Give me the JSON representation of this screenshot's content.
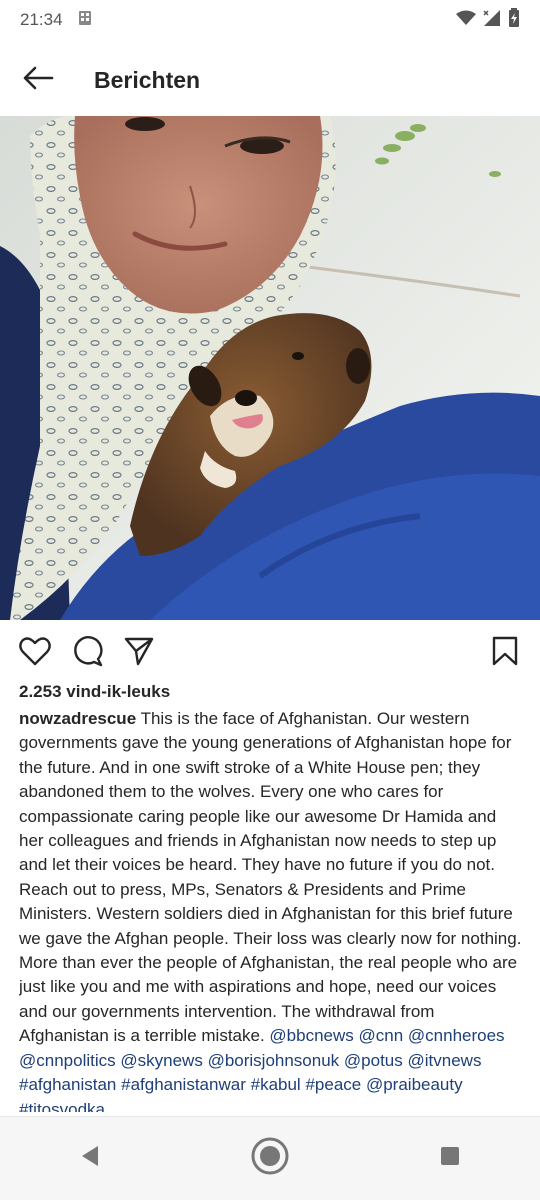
{
  "status_bar": {
    "time": "21:34",
    "icons": [
      "sim-card-icon",
      "wifi-icon",
      "signal-icon",
      "battery-charging-icon"
    ]
  },
  "header": {
    "title": "Berichten",
    "back_icon": "arrow-left-icon"
  },
  "post": {
    "photo_description_icon": "photo",
    "actions": [
      "heart-icon",
      "comment-icon",
      "share-icon",
      "bookmark-icon"
    ],
    "likes": "2.253 vind-ik-leuks",
    "username": "nowzadrescue",
    "caption_text": " This is the face of Afghanistan. Our western governments gave the young generations of Afghanistan hope for the future. And in one swift stroke of a White House pen; they abandoned them to the wolves. Every one who cares for compassionate caring people like our awesome Dr Hamida and her colleagues and friends in Afghanistan now needs to step up and let their voices be heard. They have no future if you do not. Reach out to press, MPs, Senators & Presidents and Prime Ministers. Western soldiers died in Afghanistan for this brief future we gave the Afghan people. Their loss was clearly now for nothing. More than ever the people of Afghanistan, the real people who are just like you and me with aspirations and hope, need our voices and our governments intervention. The withdrawal from Afghanistan is a terrible mistake. ",
    "tags": [
      "@bbcnews",
      "@cnn",
      "@cnnheroes",
      "@cnnpolitics",
      "@skynews",
      "@borisjohnsonuk",
      "@potus",
      "@itvnews",
      "#afghanistan",
      "#afghanistanwar",
      "#kabul",
      "#peace",
      "@praibeauty",
      "#titosvodka"
    ]
  },
  "nav_bar": {
    "icons": [
      "back-triangle-icon",
      "home-circle-icon",
      "recents-square-icon"
    ]
  },
  "colors": {
    "text": "#262626",
    "link": "#1e3f78",
    "nav_background": "#f6f6f6"
  }
}
